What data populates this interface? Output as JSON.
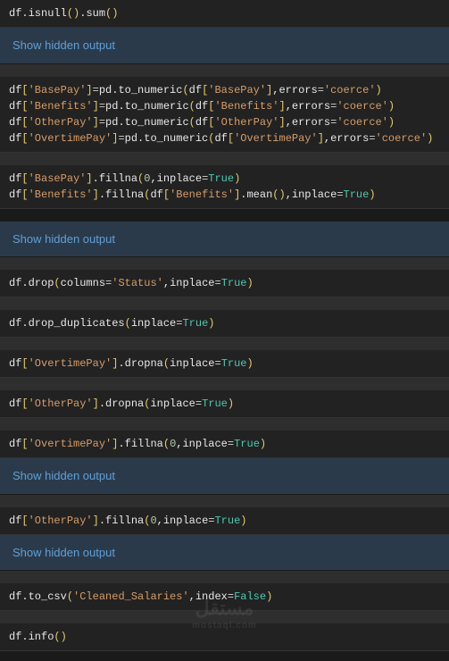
{
  "toggles": {
    "show_hidden": "Show hidden output"
  },
  "code": {
    "c1": "df.isnull().sum()",
    "c2_l1": "df['BasePay']=pd.to_numeric(df['BasePay'],errors='coerce')",
    "c2_l2": "df['Benefits']=pd.to_numeric(df['Benefits'],errors='coerce')",
    "c2_l3": "df['OtherPay']=pd.to_numeric(df['OtherPay'],errors='coerce')",
    "c2_l4": "df['OvertimePay']=pd.to_numeric(df['OvertimePay'],errors='coerce')",
    "c3_l1": "df['BasePay'].fillna(0,inplace=True)",
    "c3_l2": "df['Benefits'].fillna(df['Benefits'].mean(),inplace=True)",
    "c4": "df.drop(columns='Status',inplace=True)",
    "c5": "df.drop_duplicates(inplace=True)",
    "c6": "df['OvertimePay'].dropna(inplace=True)",
    "c7": "df['OtherPay'].dropna(inplace=True)",
    "c8": "df['OvertimePay'].fillna(0,inplace=True)",
    "c9": "df['OtherPay'].fillna(0,inplace=True)",
    "c10": "df.to_csv('Cleaned_Salaries',index=False)",
    "c11": "df.info()"
  },
  "watermark": {
    "main": "مستقل",
    "sub": "mostaql.com"
  }
}
